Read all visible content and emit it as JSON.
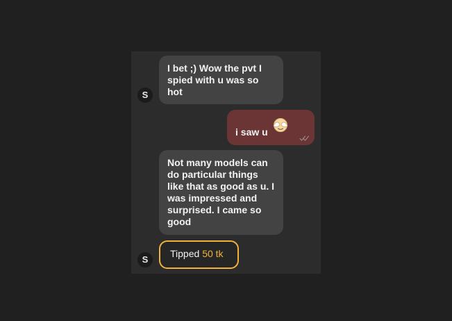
{
  "chat": {
    "sender_initial": "S",
    "messages": [
      {
        "direction": "incoming",
        "text": "I bet ;) Wow the pvt I spied with u was so hot"
      },
      {
        "direction": "outgoing",
        "text": "i saw u",
        "emoji": "see-no-evil-face-icon",
        "status_icon": "double-check-icon"
      },
      {
        "direction": "incoming",
        "text": "Not many models can do particular things like that as good as u. I was impressed and surprised. I came so good"
      }
    ],
    "tip": {
      "label": "Tipped",
      "amount": "50 tk"
    }
  },
  "colors": {
    "page_background": "#202020",
    "panel_background": "#2c2c2c",
    "incoming_bubble": "#434343",
    "outgoing_bubble": "#6b3535",
    "tip_accent": "#f0b23a"
  }
}
